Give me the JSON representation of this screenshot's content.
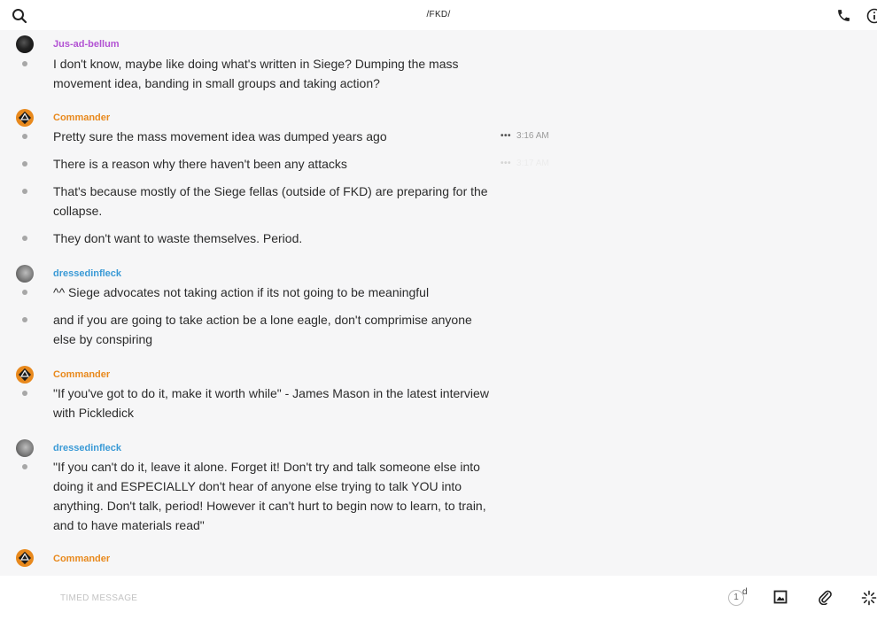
{
  "header": {
    "title": "/FKD/"
  },
  "colors": {
    "jus": "#b252d3",
    "commander": "#e8891d",
    "dressed": "#3a9ad6"
  },
  "messages": [
    {
      "author": "Jus-ad-bellum",
      "lines": [
        "I don't know, maybe like doing what's written in Siege? Dumping the mass movement idea, banding in small groups and taking action?"
      ]
    },
    {
      "author": "Commander",
      "lines": [
        "Pretty sure the mass movement idea was dumped years ago",
        "There is a reason why there haven't been any attacks",
        "That's because mostly of the Siege fellas (outside of FKD) are preparing for the collapse.",
        "They don't want to waste themselves. Period."
      ],
      "time": "3:16 AM",
      "time_faded": "3:17 AM",
      "more_label": "•••"
    },
    {
      "author": "dressedinfleck",
      "lines": [
        "^^ Siege advocates not taking action if its not going to be meaningful",
        "and if you are going to take action be a lone eagle, don't comprimise anyone else by conspiring"
      ]
    },
    {
      "author": "Commander",
      "lines": [
        "\"If you've got to do it, make it worth while\" - James Mason in the latest interview with Pickledick"
      ]
    },
    {
      "author": "dressedinfleck",
      "lines": [
        "\"If you can't do it, leave it alone. Forget it! Don't try and talk someone else into doing it and ESPECIALLY don't hear of anyone else trying to talk YOU into anything. Don't talk, period! However it can't hurt to begin now to learn, to train, and to have materials read\""
      ]
    },
    {
      "author": "Commander"
    }
  ],
  "composer": {
    "placeholder": "TIMED MESSAGE",
    "timer_value": "1",
    "timer_unit": "d"
  },
  "icons": [
    "search-icon",
    "phone-icon",
    "info-icon",
    "image-icon",
    "paperclip-icon",
    "loading-icon"
  ]
}
